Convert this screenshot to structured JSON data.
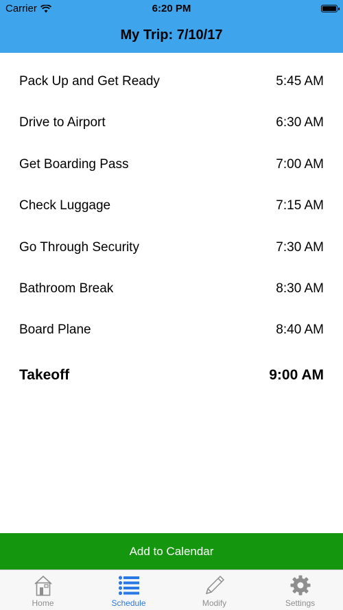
{
  "status_bar": {
    "carrier": "Carrier",
    "time": "6:20 PM"
  },
  "nav": {
    "title": "My Trip: 7/10/17"
  },
  "schedule": [
    {
      "label": "Pack Up and Get Ready",
      "time": "5:45 AM"
    },
    {
      "label": "Drive to Airport",
      "time": "6:30 AM"
    },
    {
      "label": "Get Boarding Pass",
      "time": "7:00 AM"
    },
    {
      "label": "Check Luggage",
      "time": "7:15 AM"
    },
    {
      "label": "Go Through Security",
      "time": "7:30 AM"
    },
    {
      "label": "Bathroom Break",
      "time": "8:30 AM"
    },
    {
      "label": "Board Plane",
      "time": "8:40 AM"
    }
  ],
  "final": {
    "label": "Takeoff",
    "time": "9:00 AM"
  },
  "add_button": {
    "label": "Add to Calendar"
  },
  "tabs": [
    {
      "label": "Home",
      "icon": "home-icon"
    },
    {
      "label": "Schedule",
      "icon": "list-icon",
      "active": true
    },
    {
      "label": "Modify",
      "icon": "pencil-icon"
    },
    {
      "label": "Settings",
      "icon": "gear-icon"
    }
  ],
  "colors": {
    "header": "#3ea5ec",
    "button": "#14960f",
    "tab_active": "#2a78e4",
    "tab_inactive": "#8e8e8e"
  }
}
